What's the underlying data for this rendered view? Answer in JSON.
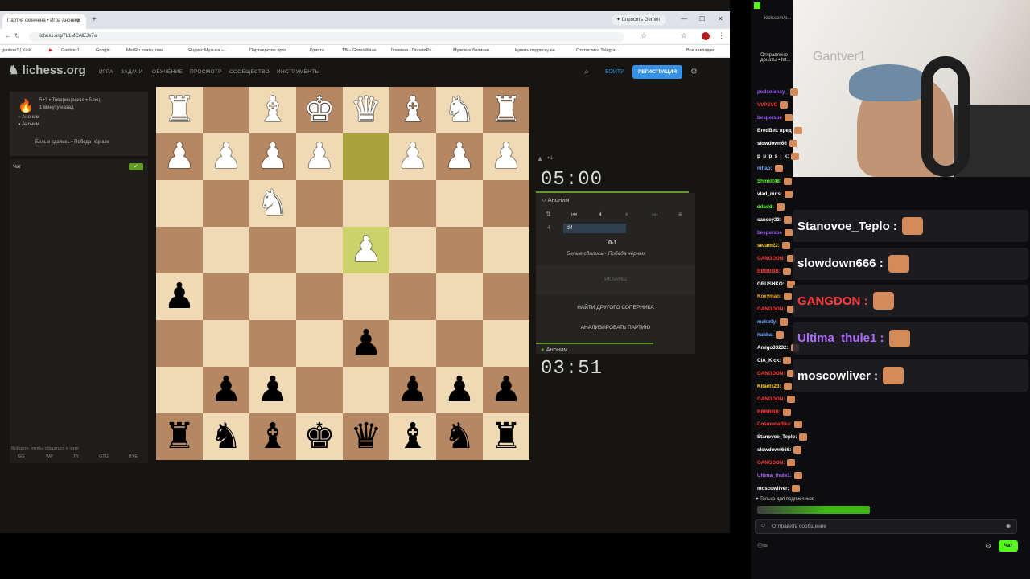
{
  "browser": {
    "tab_title": "Партия окончена • Игра Аноним",
    "gemini": "Спросить Gemini",
    "url": "lichess.org/7L1MCAlEJe7w",
    "bookmarks": [
      "gantver1 | Kick",
      "",
      "Gantver1",
      "Google",
      "MailRu почта, пои...",
      "Яндекс Музыка –...",
      "Партнерские прог...",
      "Крипта",
      "ТВ – GreenWave",
      "Главная - DonatePa...",
      "Мужские болинки...",
      "Купить подписку на...",
      "Статистика Telegra...",
      "Все закладки"
    ]
  },
  "lichess": {
    "logo": "lichess.org",
    "nav": [
      "ИГРА",
      "ЗАДАЧИ",
      "ОБУЧЕНИЕ",
      "ПРОСМОТР",
      "СООБЩЕСТВО",
      "ИНСТРУМЕНТЫ"
    ],
    "login": "ВОЙТИ",
    "register": "РЕГИСТРАЦИЯ",
    "game_info": {
      "mode": "5+3 • Товарищеская • Блиц",
      "time_ago": "1 минуту назад",
      "player1": "Аноним",
      "player2": "Аноним",
      "result": "Белые сдались • Победа чёрных"
    },
    "chat": {
      "title": "Чат",
      "login_hint": "Войдите, чтобы общаться в чате",
      "quick": [
        "GG",
        "WP",
        "TY",
        "GTG",
        "BYE"
      ]
    },
    "board": {
      "ranks": [
        [
          "wR",
          "",
          "wB",
          "wK",
          "wQ",
          "wB",
          "wN",
          "wR"
        ],
        [
          "wP",
          "wP",
          "wP",
          "wP",
          "",
          "wP",
          "wP",
          "wP"
        ],
        [
          "",
          "",
          "wN",
          "",
          "",
          "",
          "",
          ""
        ],
        [
          "",
          "",
          "",
          "",
          "wP",
          "",
          "",
          ""
        ],
        [
          "bP",
          "",
          "",
          "",
          "",
          "",
          "",
          ""
        ],
        [
          "",
          "",
          "",
          "",
          "bP",
          "",
          "",
          ""
        ],
        [
          "",
          "bP",
          "bP",
          "",
          "",
          "bP",
          "bP",
          "bP"
        ],
        [
          "bR",
          "bN",
          "bB",
          "bK",
          "bQ",
          "bB",
          "bN",
          "bR"
        ]
      ]
    },
    "top_player": {
      "clock": "05:00",
      "name": "Аноним",
      "extra": "+1"
    },
    "bottom_player": {
      "clock": "03:51",
      "name": "Аноним"
    },
    "moves": {
      "num": "4",
      "move": "d4",
      "score": "0-1",
      "result": "Белые сдались • Победа чёрных"
    },
    "buttons": {
      "rematch": "РЕВАНШ",
      "new_opponent": "НАЙТИ ДРУГОГО СОПЕРНИКА",
      "analyze": "АНАЛИЗИРОВАТЬ ПАРТИЮ"
    }
  },
  "stream": {
    "watermark": "Gantver1",
    "top_notice": "Отправлено донаты • htt...",
    "chat_lines": [
      {
        "name": "podsolenay_",
        "color": "#9b59ff"
      },
      {
        "name": "VVPSVO",
        "color": "#ff3b3b"
      },
      {
        "name": "besperspe",
        "color": "#9b59ff"
      },
      {
        "name": "BredBet: пред",
        "color": "#ffffff"
      },
      {
        "name": "slowdown66",
        "color": "#ffffff"
      },
      {
        "name": "p_u_p_s_i_k:",
        "color": "#ffffff"
      },
      {
        "name": "nihao:",
        "color": "#6fa8ff"
      },
      {
        "name": "Shmidt48:",
        "color": "#53fc18"
      },
      {
        "name": "vlad_nuts:",
        "color": "#ffffff"
      },
      {
        "name": "ddadd:",
        "color": "#53fc18"
      },
      {
        "name": "sansey23:",
        "color": "#ffffff"
      },
      {
        "name": "besperspe",
        "color": "#9b59ff"
      },
      {
        "name": "sezam22:",
        "color": "#ffd400"
      },
      {
        "name": "GANGDON:",
        "color": "#ff3b3b"
      },
      {
        "name": "BBBBBB:",
        "color": "#ff3b3b"
      },
      {
        "name": "GRUSHKO:",
        "color": "#ffffff"
      },
      {
        "name": "Koxyman:",
        "color": "#ffa500"
      },
      {
        "name": "GANGDON:",
        "color": "#ff3b3b"
      },
      {
        "name": "makb0y:",
        "color": "#6fa8ff"
      },
      {
        "name": "habba:",
        "color": "#6fa8ff"
      },
      {
        "name": "Amigo33232:",
        "color": "#ffffff"
      },
      {
        "name": "CIA_Kick:",
        "color": "#ffffff"
      },
      {
        "name": "GANGDON:",
        "color": "#ff3b3b"
      },
      {
        "name": "Kitaets23:",
        "color": "#ffd400"
      },
      {
        "name": "GANGDON:",
        "color": "#ff3b3b"
      },
      {
        "name": "BBBBBB:",
        "color": "#ff3b3b"
      },
      {
        "name": "Cosmonaftika:",
        "color": "#ff3b3b"
      },
      {
        "name": "Stanovoe_Teplo:",
        "color": "#ffffff"
      },
      {
        "name": "slowdown666:",
        "color": "#ffffff"
      },
      {
        "name": "GANGDON:",
        "color": "#ff3b3b"
      },
      {
        "name": "Ultima_thule1:",
        "color": "#b06bff"
      },
      {
        "name": "moscowliver:",
        "color": "#ffffff"
      }
    ],
    "big_messages": [
      {
        "name": "Stanovoe_Teplo :",
        "color": "#ffffff"
      },
      {
        "name": "slowdown666 :",
        "color": "#ffffff"
      },
      {
        "name": "GANGDON :",
        "color": "#ff3b3b"
      },
      {
        "name": "Ultima_thule1 :",
        "color": "#b06bff"
      },
      {
        "name": "moscowliver :",
        "color": "#ffffff"
      }
    ],
    "subs_only": "Только для подписчиков",
    "send_placeholder": "Отправить сообщение",
    "chat_button": "Чат"
  }
}
